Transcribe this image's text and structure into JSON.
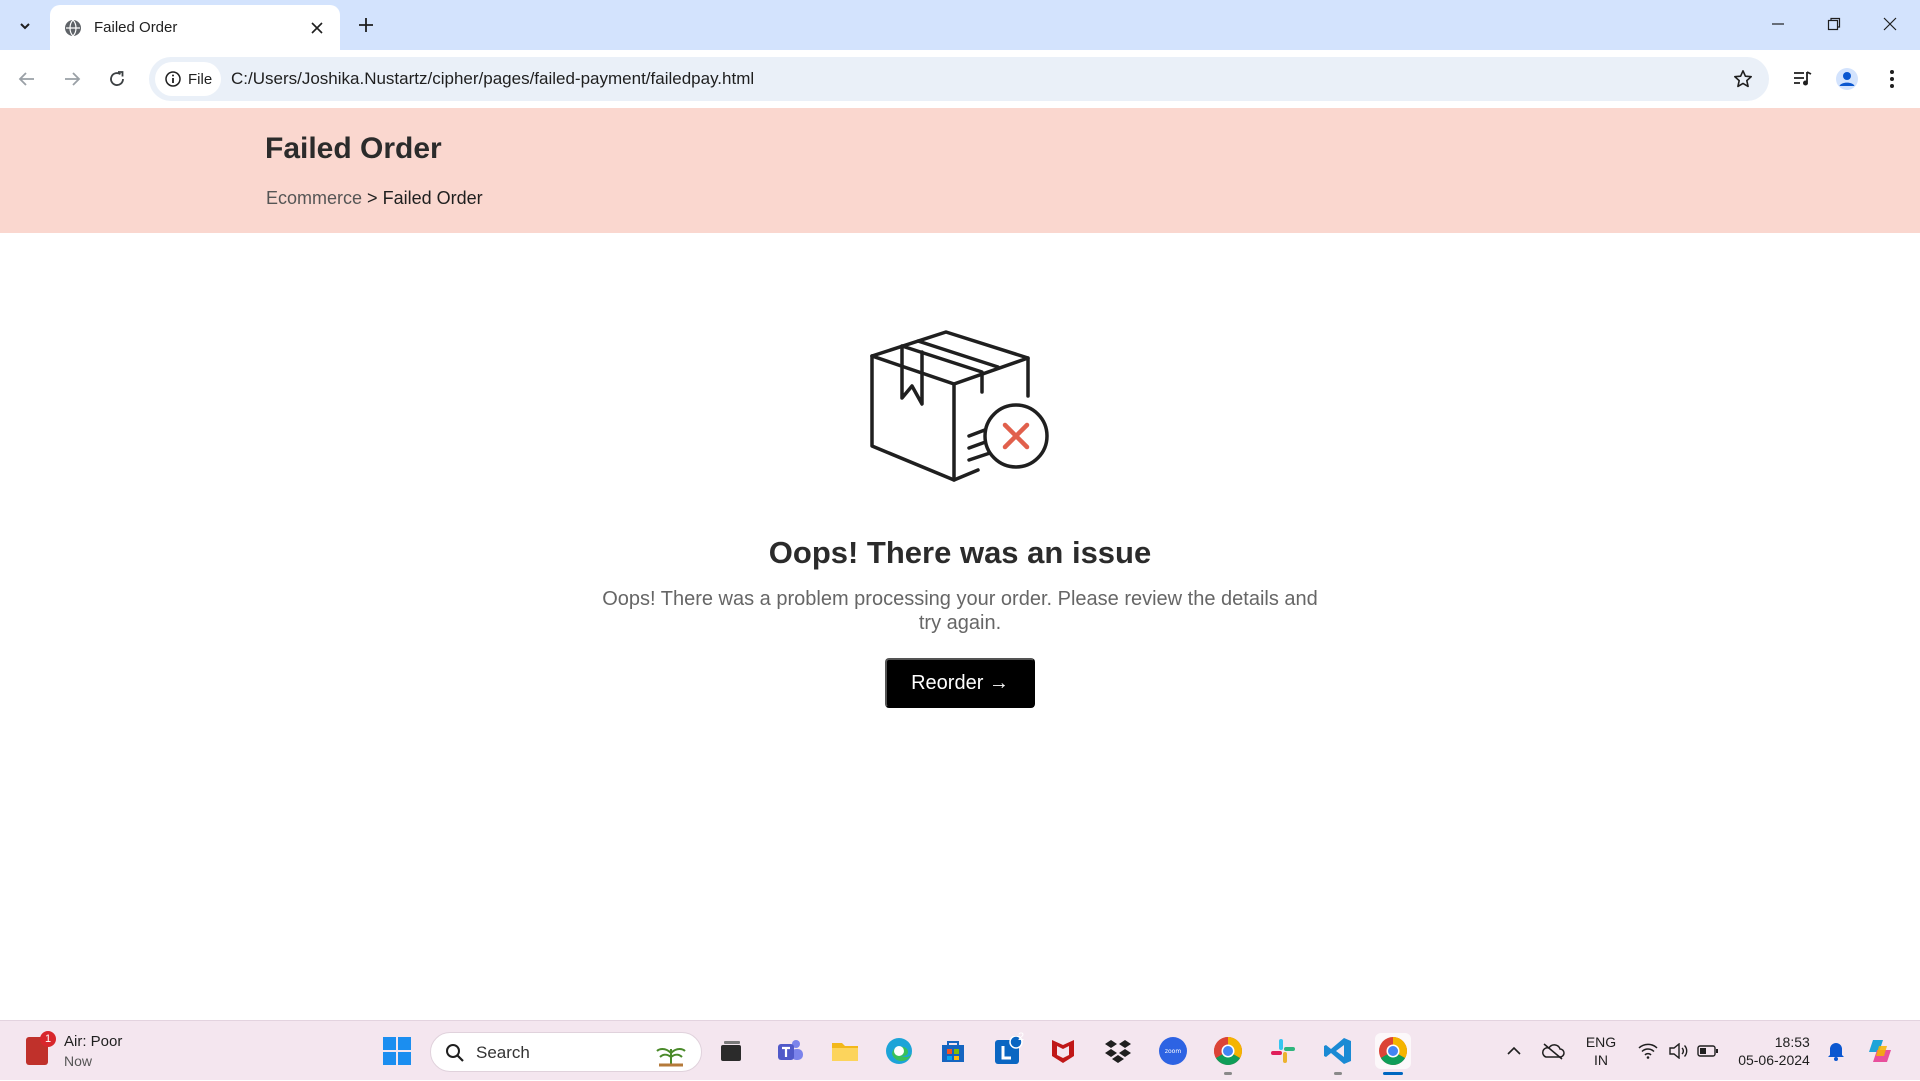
{
  "browser": {
    "tab_title": "Failed Order",
    "address_chip_label": "File",
    "url": "C:/Users/Joshika.Nustartz/cipher/pages/failed-payment/failedpay.html"
  },
  "page": {
    "title": "Failed Order",
    "breadcrumb": {
      "root": "Ecommerce",
      "separator": ">",
      "current": "Failed Order"
    },
    "headline": "Oops! There was an issue",
    "message": "Oops! There was a problem processing your order. Please review the details and try again.",
    "reorder_label": "Reorder →",
    "header_color": "#fad7cf",
    "error_accent_color": "#e1604c",
    "illustration_icon": "package-failed-icon"
  },
  "taskbar": {
    "weather_title": "Air: Poor",
    "weather_subtitle": "Now",
    "weather_badge": "1",
    "search_placeholder": "Search",
    "linkedin_badge": "2",
    "zoom_label": "zoom",
    "language_line1": "ENG",
    "language_line2": "IN",
    "time": "18:53",
    "date": "05-06-2024"
  }
}
